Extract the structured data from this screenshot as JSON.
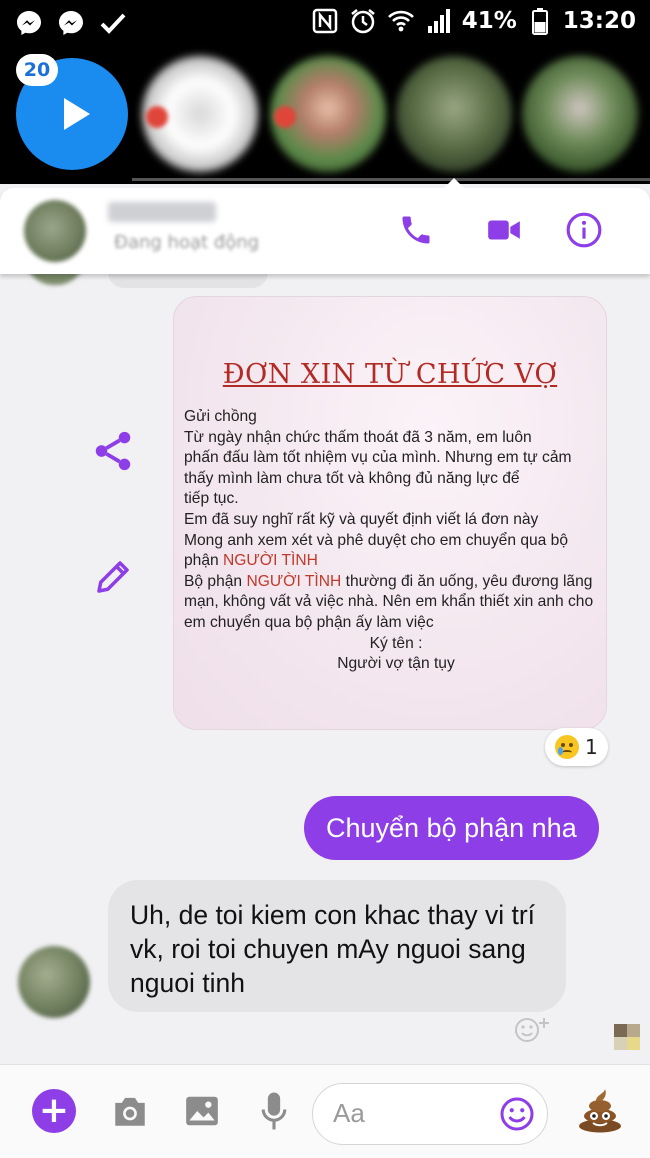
{
  "status_bar": {
    "battery": "41%",
    "time": "13:20"
  },
  "chat_heads": {
    "badge": "20"
  },
  "conversation": {
    "contact_status": "Đang hoạt động"
  },
  "letter": {
    "title": "ĐƠN XIN TỪ CHỨC VỢ",
    "lines": {
      "l1": "Gửi chồng",
      "l2": "Từ ngày nhận chức thấm thoát đã 3 năm, em luôn",
      "l3": "phấn đấu làm tốt nhiệm vụ của mình. Nhưng em tự cảm",
      "l4": "thấy mình làm chưa tốt và không đủ năng lực để",
      "l5": "tiếp tục.",
      "l6": "Em đã suy nghĩ rất kỹ và quyết định viết lá đơn này",
      "l7": "Mong anh xem xét và phê duyệt cho em chuyển qua bộ",
      "l8a": "phận ",
      "l8b": "NGƯỜI TÌNH",
      "l9a": "Bộ phận ",
      "l9b": "NGƯỜI TÌNH",
      "l9c": " thường đi ăn uống, yêu đương lãng",
      "l10": "mạn, không vất vả việc nhà. Nên em khẩn thiết xin anh cho",
      "l11": "em chuyển qua bộ phận ấy làm việc",
      "l12": "Ký tên :",
      "l13": "Người vợ tận tụy"
    }
  },
  "reaction": {
    "emoji": "crying-face",
    "count": "1"
  },
  "messages": {
    "sent": "Chuyển bộ phận nha",
    "received": "Uh, de toi kiem con khac thay vi trí vk, roi toi chuyen mAy nguoi sang nguoi tinh"
  },
  "composer": {
    "placeholder": "Aa"
  },
  "colors": {
    "accent": "#8d3ee6",
    "messenger_blue": "#1a8cf0",
    "letter_title_red": "#b22a24"
  }
}
